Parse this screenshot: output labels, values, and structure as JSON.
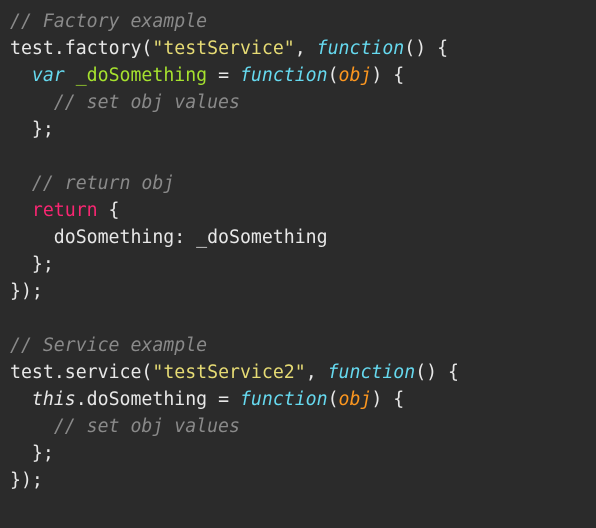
{
  "code": {
    "l1": {
      "a": "// Factory example"
    },
    "l2": {
      "a": "test",
      "b": ".",
      "c": "factory",
      "d": "(",
      "e": "\"testService\"",
      "f": ", ",
      "g": "function",
      "h": "() {"
    },
    "l3": {
      "a": "  ",
      "b": "var",
      "c": " ",
      "d": "_doSomething",
      "e": " = ",
      "f": "function",
      "g": "(",
      "h": "obj",
      "i": ") {"
    },
    "l4": {
      "a": "    ",
      "b": "// set obj values"
    },
    "l5": {
      "a": "  };"
    },
    "l6": {
      "a": ""
    },
    "l7": {
      "a": "  ",
      "b": "// return obj"
    },
    "l8": {
      "a": "  ",
      "b": "return",
      "c": " {"
    },
    "l9": {
      "a": "    doSomething: _doSomething"
    },
    "l10": {
      "a": "  };"
    },
    "l11": {
      "a": "});"
    },
    "l12": {
      "a": ""
    },
    "l13": {
      "a": "// Service example"
    },
    "l14": {
      "a": "test",
      "b": ".",
      "c": "service",
      "d": "(",
      "e": "\"testService2\"",
      "f": ", ",
      "g": "function",
      "h": "() {"
    },
    "l15": {
      "a": "  ",
      "b": "this",
      "c": ".doSomething = ",
      "d": "function",
      "e": "(",
      "f": "obj",
      "g": ") {"
    },
    "l16": {
      "a": "    ",
      "b": "// set obj values"
    },
    "l17": {
      "a": "  };"
    },
    "l18": {
      "a": "});"
    }
  }
}
